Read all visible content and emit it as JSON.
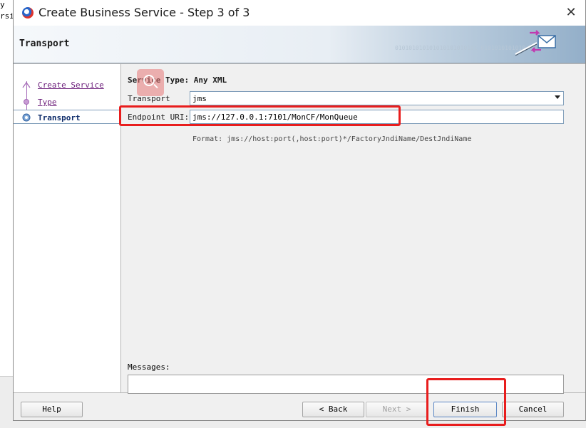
{
  "background": {
    "fragments": [
      "y",
      "rsi"
    ]
  },
  "dialog": {
    "title": "Create Business Service - Step 3 of 3",
    "close_glyph": "✕",
    "banner_title": "Transport",
    "banner_decoration": "010101010101010101010101 0101010101010",
    "banner_icon": "envelope-arrows-icon"
  },
  "steps": [
    {
      "label": "Create Service",
      "state": "completed"
    },
    {
      "label": "Type",
      "state": "completed"
    },
    {
      "label": "Transport",
      "state": "active"
    }
  ],
  "form": {
    "service_type": "Service Type: Any XML",
    "transport_label": "Transport",
    "transport_value": "jms",
    "endpoint_label": "Endpoint URI:",
    "endpoint_value": "jms://127.0.0.1:7101/MonCF/MonQueue",
    "format_hint": "Format:  jms://host:port(,host:port)*/FactoryJndiName/DestJndiName",
    "messages_label": "Messages:",
    "messages_value": ""
  },
  "footer": {
    "help": "Help",
    "back": "< Back",
    "next": "Next >",
    "finish": "Finish",
    "cancel": "Cancel"
  },
  "annotations": {
    "highlight_color": "#e81d1d"
  }
}
